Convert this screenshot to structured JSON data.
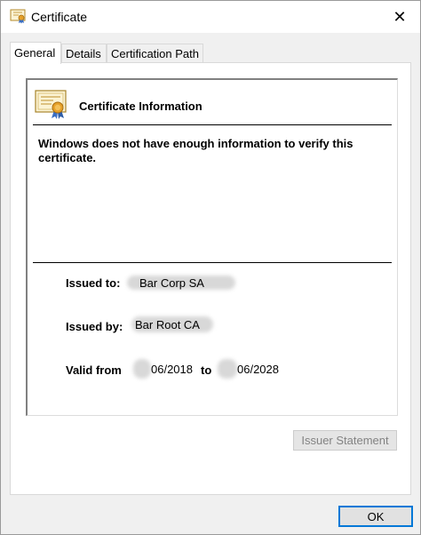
{
  "window": {
    "title": "Certificate",
    "close_glyph": "✕"
  },
  "tabs": [
    {
      "label": "General",
      "active": true
    },
    {
      "label": "Details",
      "active": false
    },
    {
      "label": "Certification Path",
      "active": false
    }
  ],
  "general": {
    "section_title": "Certificate Information",
    "warning": "Windows does not have enough information to verify this certificate.",
    "issued_to_label": "Issued to:",
    "issued_to_value": "Bar Corp SA",
    "issued_by_label": "Issued by:",
    "issued_by_value": "Bar Root CA",
    "valid_from_label": "Valid from",
    "valid_from_value": "06/2018",
    "valid_to_label": "to",
    "valid_to_value": "06/2028"
  },
  "buttons": {
    "issuer_statement": "Issuer Statement",
    "ok": "OK"
  },
  "colors": {
    "accent": "#0078d7",
    "disabled_text": "#838383"
  },
  "icons": {
    "title": "certificate-icon",
    "section": "certificate-icon",
    "close": "close-icon"
  }
}
